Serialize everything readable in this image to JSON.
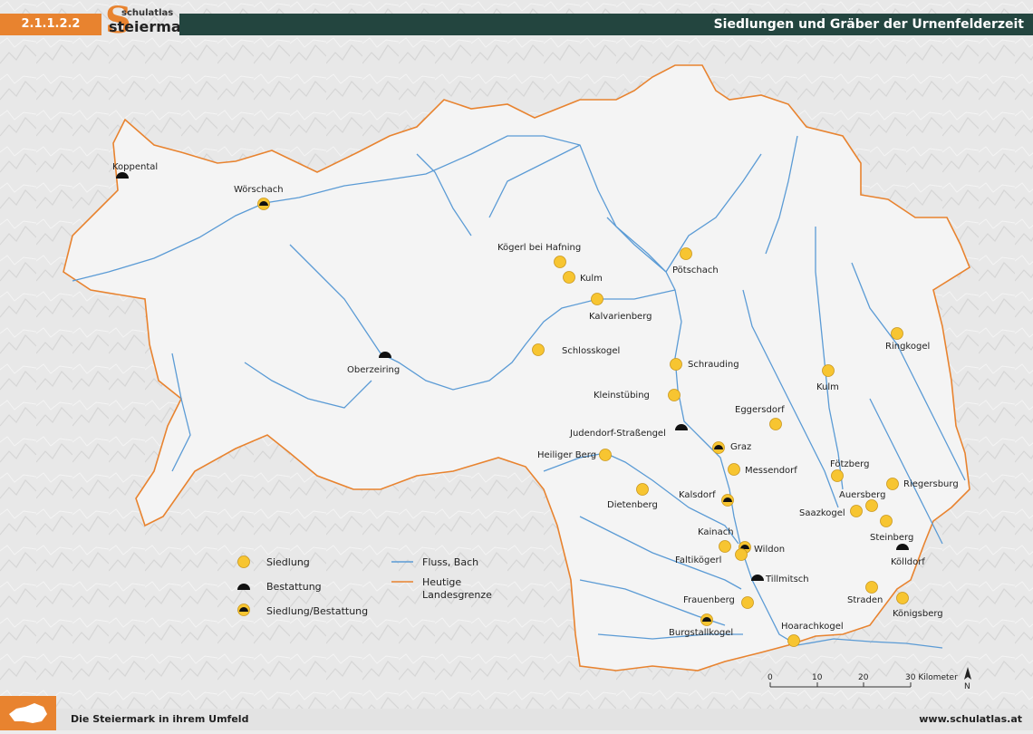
{
  "header": {
    "code": "2.1.1.2.2",
    "logo_top": "schulatlas",
    "logo_bottom": "steiermark",
    "title": "Siedlungen und Gräber der Urnenfelderzeit"
  },
  "footer": {
    "left": "Die Steiermark in ihrem Umfeld",
    "right": "www.schulatlas.at"
  },
  "colors": {
    "settlement": "#f7c531",
    "burial": "#111111",
    "river": "#5b9bd5",
    "border": "#e8832f",
    "header_bar": "#23453f"
  },
  "legend": {
    "siedlung": "Siedlung",
    "bestattung": "Bestattung",
    "beides": "Siedlung/Bestattung",
    "fluss": "Fluss, Bach",
    "grenze_1": "Heutige",
    "grenze_2": "Landesgrenze"
  },
  "scale": {
    "ticks": [
      "0",
      "10",
      "20",
      "30 Kilometer"
    ],
    "north": "N"
  },
  "sites": [
    {
      "name": "Koppental",
      "type": "bestattung"
    },
    {
      "name": "Wörschach",
      "type": "beides"
    },
    {
      "name": "Kögerl bei Hafning",
      "type": "siedlung"
    },
    {
      "name": "Kulm",
      "type": "siedlung"
    },
    {
      "name": "Kalvarienberg",
      "type": "siedlung"
    },
    {
      "name": "Pötschach",
      "type": "siedlung"
    },
    {
      "name": "Schlosskogel",
      "type": "siedlung"
    },
    {
      "name": "Oberzeiring",
      "type": "bestattung"
    },
    {
      "name": "Schrauding",
      "type": "siedlung"
    },
    {
      "name": "Kleinstübing",
      "type": "siedlung"
    },
    {
      "name": "Judendorf-Straßengel",
      "type": "bestattung"
    },
    {
      "name": "Graz",
      "type": "beides"
    },
    {
      "name": "Eggersdorf",
      "type": "siedlung"
    },
    {
      "name": "Kulm",
      "type": "siedlung"
    },
    {
      "name": "Ringkogel",
      "type": "siedlung"
    },
    {
      "name": "Heiliger Berg",
      "type": "siedlung"
    },
    {
      "name": "Messendorf",
      "type": "siedlung"
    },
    {
      "name": "Dietenberg",
      "type": "siedlung"
    },
    {
      "name": "Kalsdorf",
      "type": "beides"
    },
    {
      "name": "Fötzberg",
      "type": "siedlung"
    },
    {
      "name": "Riegersburg",
      "type": "siedlung"
    },
    {
      "name": "Auersberg",
      "type": "siedlung"
    },
    {
      "name": "Saazkogel",
      "type": "siedlung"
    },
    {
      "name": "Steinberg",
      "type": "siedlung"
    },
    {
      "name": "Kölldorf",
      "type": "bestattung"
    },
    {
      "name": "Kainach",
      "type": "siedlung"
    },
    {
      "name": "Wildon",
      "type": "beides"
    },
    {
      "name": "Faltikögerl",
      "type": "siedlung"
    },
    {
      "name": "Tillmitsch",
      "type": "bestattung"
    },
    {
      "name": "Frauenberg",
      "type": "siedlung"
    },
    {
      "name": "Burgstallkogel",
      "type": "beides"
    },
    {
      "name": "Hoarachkogel",
      "type": "siedlung"
    },
    {
      "name": "Straden",
      "type": "siedlung"
    },
    {
      "name": "Königsberg",
      "type": "siedlung"
    }
  ]
}
